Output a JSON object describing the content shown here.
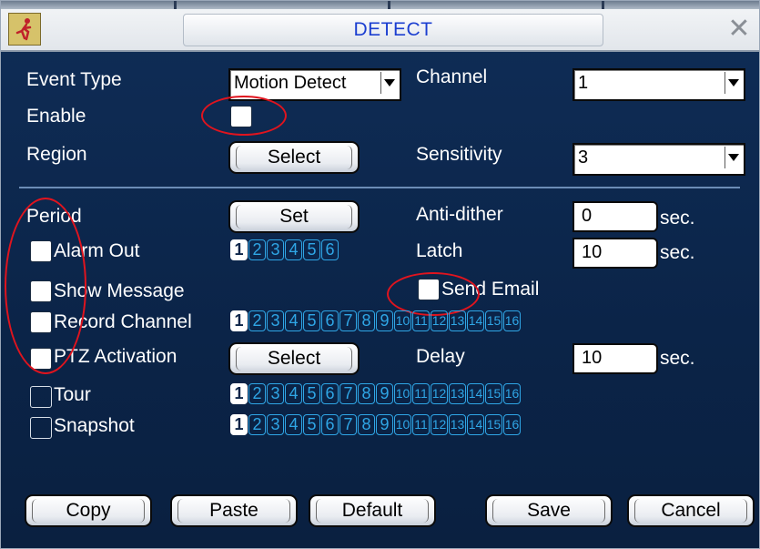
{
  "window": {
    "title": "DETECT"
  },
  "icons": {
    "logo": "running-man-icon",
    "close": "close-icon",
    "dropdown": "triangle-down-icon"
  },
  "event_type": {
    "label": "Event Type",
    "value": "Motion Detect"
  },
  "channel": {
    "label": "Channel",
    "value": "1"
  },
  "enable": {
    "label": "Enable"
  },
  "region": {
    "label": "Region",
    "button": "Select"
  },
  "sensitivity": {
    "label": "Sensitivity",
    "value": "3"
  },
  "period": {
    "label": "Period",
    "button": "Set"
  },
  "anti_dither": {
    "label": "Anti-dither",
    "value": "0",
    "unit": "sec."
  },
  "alarm_out": {
    "label": "Alarm Out",
    "channels": [
      "1",
      "2",
      "3",
      "4",
      "5",
      "6"
    ]
  },
  "latch": {
    "label": "Latch",
    "value": "10",
    "unit": "sec."
  },
  "show_message": {
    "label": "Show Message"
  },
  "send_email": {
    "label": "Send Email"
  },
  "record_channel": {
    "label": "Record Channel"
  },
  "ptz_activation": {
    "label": "PTZ Activation",
    "button": "Select"
  },
  "delay": {
    "label": "Delay",
    "value": "10",
    "unit": "sec."
  },
  "tour": {
    "label": "Tour"
  },
  "snapshot": {
    "label": "Snapshot"
  },
  "channel_numbers": [
    "1",
    "2",
    "3",
    "4",
    "5",
    "6",
    "7",
    "8",
    "9",
    "10",
    "11",
    "12",
    "13",
    "14",
    "15",
    "16"
  ],
  "footer": {
    "copy": "Copy",
    "paste": "Paste",
    "default": "Default",
    "save": "Save",
    "cancel": "Cancel"
  },
  "colors": {
    "background": "#0b2448",
    "accent": "#2fa6e6",
    "title_text": "#1c3fd0",
    "annotation": "#e0141e"
  }
}
